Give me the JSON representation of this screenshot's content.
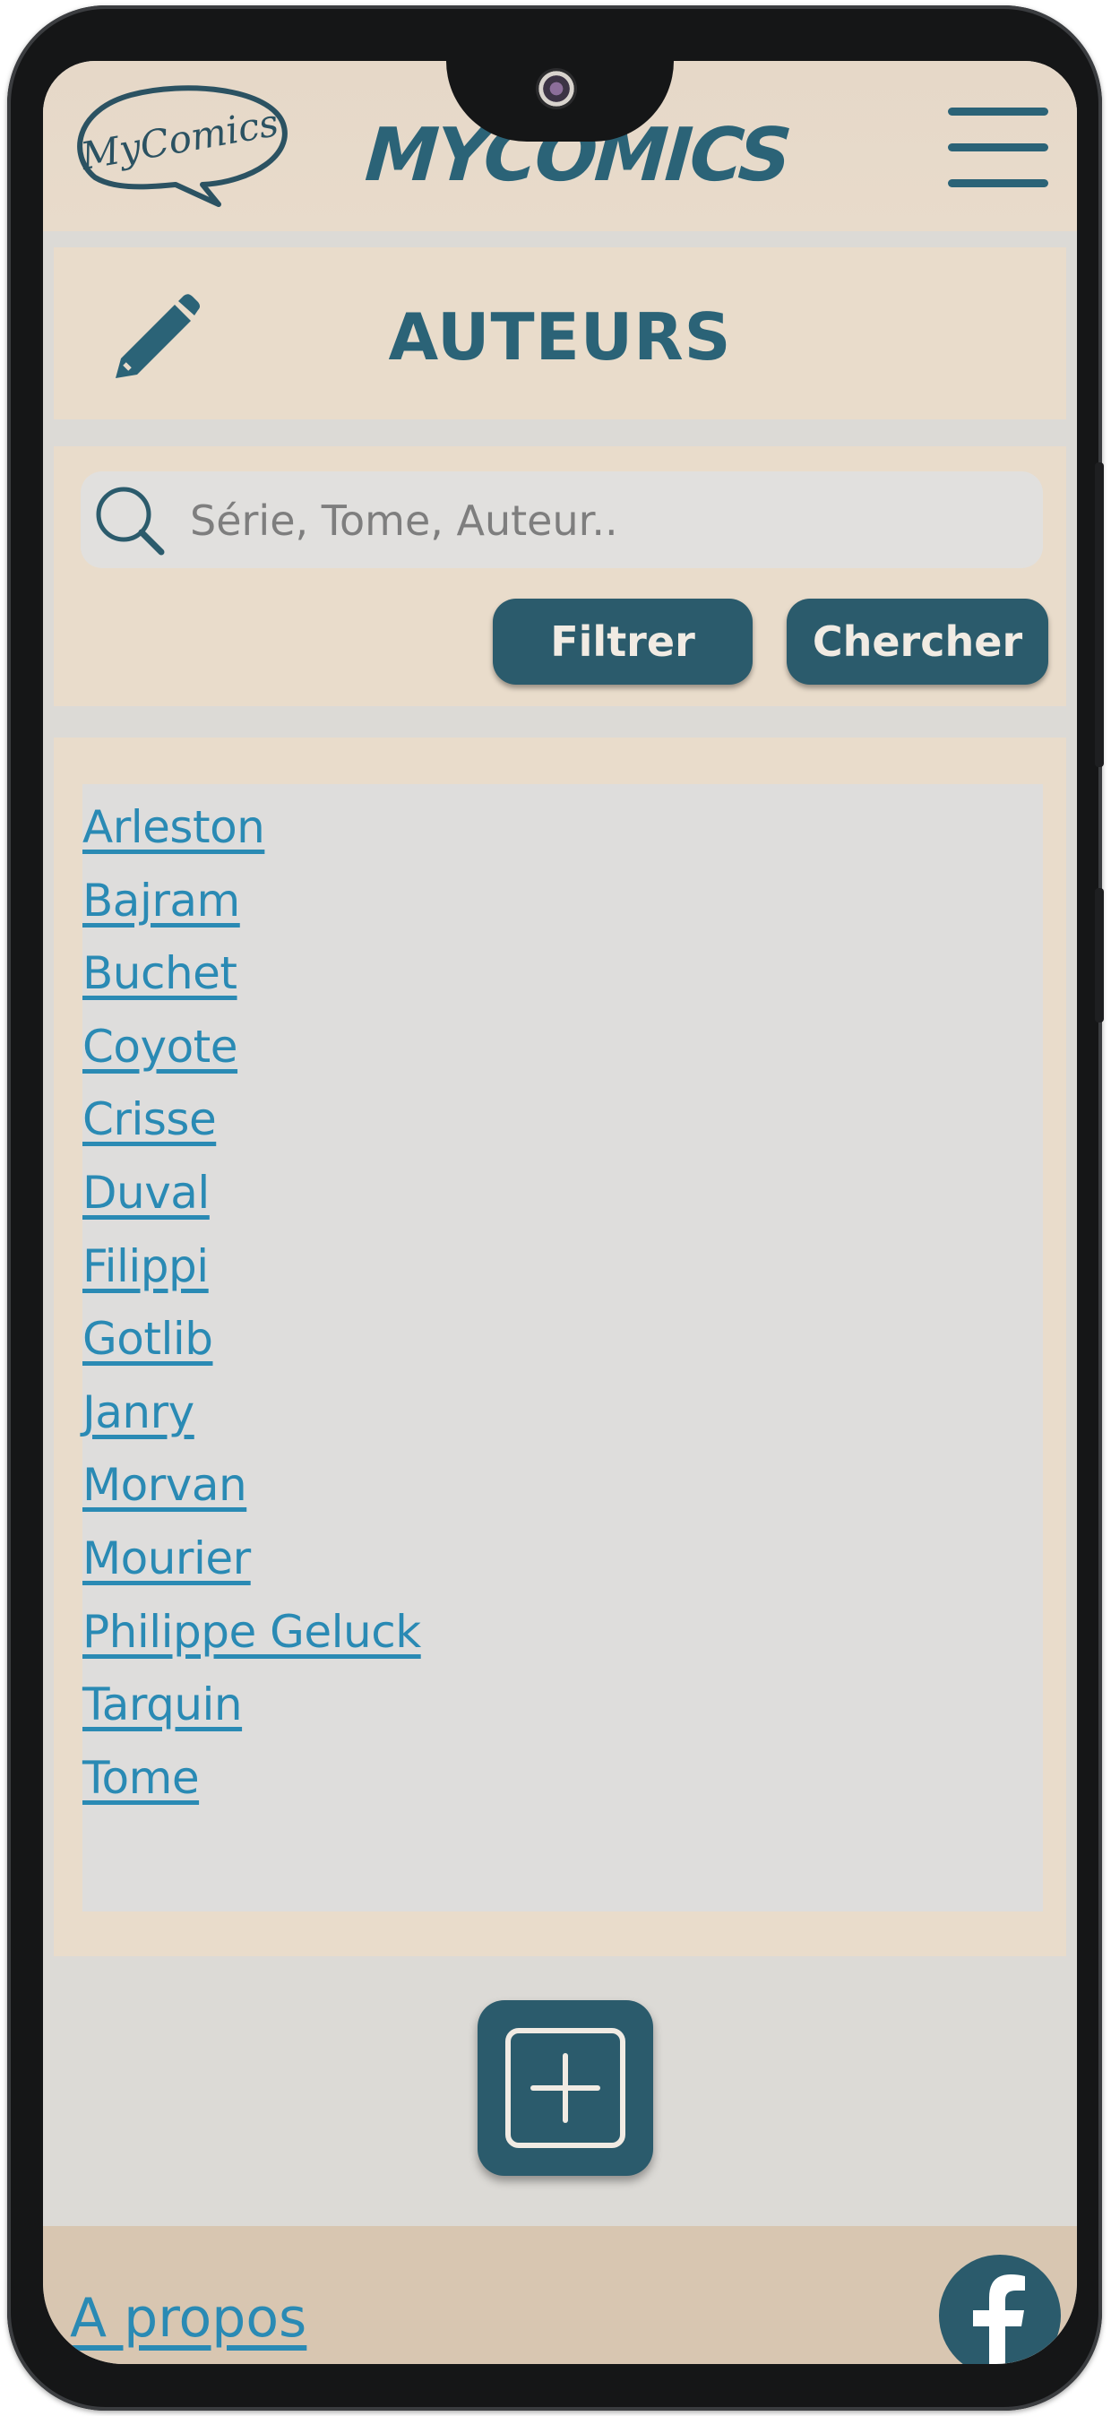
{
  "header": {
    "logo_text": "MyComics",
    "brand": "MYCOMICS"
  },
  "page": {
    "title": "AUTEURS"
  },
  "search": {
    "placeholder": "Série, Tome, Auteur..",
    "value": "",
    "filter_label": "Filtrer",
    "search_label": "Chercher"
  },
  "authors": [
    "Arleston",
    "Bajram",
    "Buchet",
    "Coyote",
    "Crisse",
    "Duval",
    "Filippi",
    "Gotlib",
    "Janry",
    "Morvan",
    "Mourier",
    "Philippe Geluck",
    "Tarquin",
    "Tome"
  ],
  "footer": {
    "about_label": "A propos"
  },
  "icons": {
    "menu": "hamburger-icon",
    "edit": "pencil-icon",
    "search": "search-icon",
    "add": "plus-square-icon",
    "social": "facebook-icon"
  },
  "colors": {
    "accent": "#2b6377",
    "button": "#2b5b6c",
    "link": "#2a8ab4",
    "panel": "#e9dccb",
    "footer": "#d8c6b1"
  }
}
